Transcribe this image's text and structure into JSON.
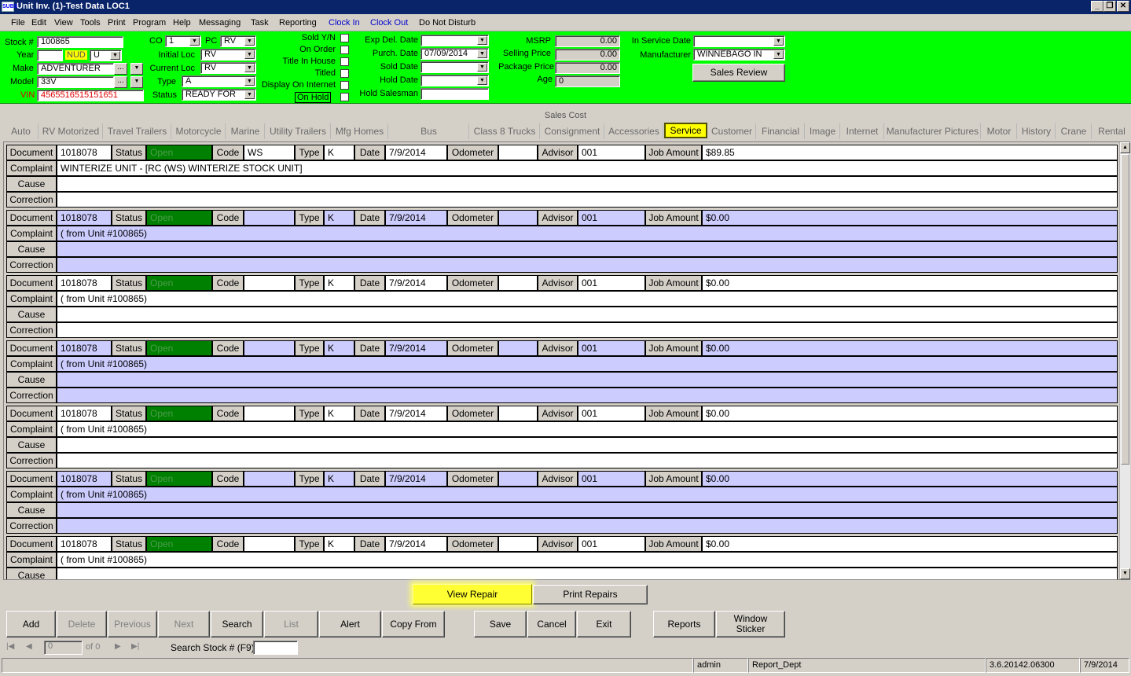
{
  "window": {
    "title": "Unit Inv. (1)-Test Data LOC1",
    "icon": "SUBS",
    "minimize": "_",
    "restore": "❐",
    "close": "✕"
  },
  "menu": [
    "File",
    "Edit",
    "View",
    "Tools",
    "Print",
    "Program",
    "Help",
    "Messaging",
    "Task",
    "Reporting",
    "Clock In",
    "Clock Out",
    "Do Not Disturb"
  ],
  "header": {
    "stock_label": "Stock #",
    "stock_value": "100865",
    "year_label": "Year",
    "year_value": "",
    "nud_label": "NUD",
    "nud_value": "U",
    "make_label": "Make",
    "make_value": "ADVENTURER",
    "make_btn": "...",
    "model_label": "Model",
    "model_value": "33V",
    "model_btn": "...",
    "vin_label": "VIN",
    "vin_value": "4565516515151651",
    "co_label": "CO",
    "co_value": "1",
    "pc_label": "PC",
    "pc_value": "RV",
    "initial_loc_label": "Initial Loc",
    "initial_loc_value": "RV",
    "current_loc_label": "Current Loc",
    "current_loc_value": "RV",
    "type_label": "Type",
    "type_value": "A",
    "status_label": "Status",
    "status_value": "READY FOR",
    "sold_label": "Sold Y/N",
    "on_order_label": "On Order",
    "title_in_house_label": "Title In House",
    "titled_label": "Titled",
    "display_internet_label": "Display On Internet",
    "on_hold_label": "On Hold",
    "exp_del_label": "Exp Del. Date",
    "exp_del_value": "",
    "purch_label": "Purch. Date",
    "purch_value": "07/09/2014",
    "sold_date_label": "Sold Date",
    "sold_date_value": "",
    "hold_date_label": "Hold Date",
    "hold_date_value": "",
    "hold_salesman_label": "Hold Salesman",
    "hold_salesman_value": "",
    "msrp_label": "MSRP",
    "msrp_value": "0.00",
    "selling_label": "Selling Price",
    "selling_value": "0.00",
    "package_label": "Package Price",
    "package_value": "0.00",
    "age_label": "Age",
    "age_value": "0",
    "in_service_label": "In Service Date",
    "in_service_value": "",
    "manufacturer_label": "Manufacturer",
    "manufacturer_value": "WINNEBAGO IN",
    "sales_review_label": "Sales Review"
  },
  "sales_cost_label": "Sales Cost",
  "tabs": [
    "Auto",
    "RV Motorized",
    "Travel Trailers",
    "Motorcycle",
    "Marine",
    "Utility Trailers",
    "Mfg Homes",
    "Bus",
    "Class 8 Trucks",
    "Consignment",
    "Accessories",
    "Service",
    "Customer",
    "Financial",
    "Image",
    "Internet",
    "Manufacturer Pictures",
    "Motor",
    "History",
    "Crane",
    "Rental"
  ],
  "active_tab": "Service",
  "labels": {
    "document": "Document",
    "status": "Status",
    "code": "Code",
    "type": "Type",
    "date": "Date",
    "odometer": "Odometer",
    "advisor": "Advisor",
    "job_amount": "Job Amount",
    "complaint": "Complaint",
    "cause": "Cause",
    "correction": "Correction"
  },
  "records": [
    {
      "document": "1018078",
      "status": "Open",
      "code": "WS",
      "type": "K",
      "date": "7/9/2014",
      "odometer": "",
      "advisor": "001",
      "job_amount": "$89.85",
      "complaint": "WINTERIZE UNIT - [RC (WS)  WINTERIZE STOCK UNIT]",
      "cause": "",
      "correction": ""
    },
    {
      "document": "1018078",
      "status": "Open",
      "code": "",
      "type": "K",
      "date": "7/9/2014",
      "odometer": "",
      "advisor": "001",
      "job_amount": "$0.00",
      "complaint": " ( from Unit #100865)",
      "cause": "",
      "correction": ""
    },
    {
      "document": "1018078",
      "status": "Open",
      "code": "",
      "type": "K",
      "date": "7/9/2014",
      "odometer": "",
      "advisor": "001",
      "job_amount": "$0.00",
      "complaint": " ( from Unit #100865)",
      "cause": "",
      "correction": ""
    },
    {
      "document": "1018078",
      "status": "Open",
      "code": "",
      "type": "K",
      "date": "7/9/2014",
      "odometer": "",
      "advisor": "001",
      "job_amount": "$0.00",
      "complaint": " ( from Unit #100865)",
      "cause": "",
      "correction": ""
    },
    {
      "document": "1018078",
      "status": "Open",
      "code": "",
      "type": "K",
      "date": "7/9/2014",
      "odometer": "",
      "advisor": "001",
      "job_amount": "$0.00",
      "complaint": " ( from Unit #100865)",
      "cause": "",
      "correction": ""
    },
    {
      "document": "1018078",
      "status": "Open",
      "code": "",
      "type": "K",
      "date": "7/9/2014",
      "odometer": "",
      "advisor": "001",
      "job_amount": "$0.00",
      "complaint": " ( from Unit #100865)",
      "cause": "",
      "correction": ""
    },
    {
      "document": "1018078",
      "status": "Open",
      "code": "",
      "type": "K",
      "date": "7/9/2014",
      "odometer": "",
      "advisor": "001",
      "job_amount": "$0.00",
      "complaint": " ( from Unit #100865)",
      "cause": "",
      "correction": ""
    }
  ],
  "service_buttons": {
    "view_repair": "View Repair",
    "print_repairs": "Print Repairs"
  },
  "toolbar": {
    "add": "Add",
    "delete": "Delete",
    "previous": "Previous",
    "next": "Next",
    "search": "Search",
    "list": "List",
    "alert": "Alert",
    "copy_from": "Copy From",
    "save": "Save",
    "cancel": "Cancel",
    "exit": "Exit",
    "reports": "Reports",
    "window_sticker": "Window Sticker"
  },
  "navigator": {
    "position": "0",
    "of": "of 0",
    "search_label": "Search Stock # (F9):",
    "search_value": ""
  },
  "statusbar": {
    "user": "admin",
    "dept": "Report_Dept",
    "version": "3.6.20142.06300",
    "date": "7/9/2014"
  },
  "colors": {
    "header_bg": "#00ff00",
    "status_open": "#008000",
    "alt_row": "#ccccff",
    "highlight": "#ffff00",
    "titlebar": "#0a246a"
  }
}
